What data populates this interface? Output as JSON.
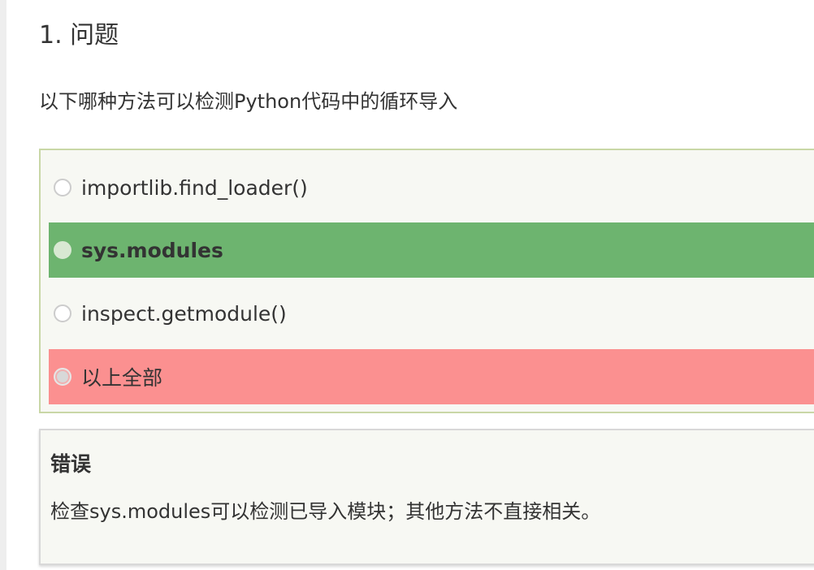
{
  "question": {
    "title": "1. 问题",
    "text": "以下哪种方法可以检测Python代码中的循环导入"
  },
  "options": [
    {
      "label": "importlib.find_loader()",
      "state": "neutral"
    },
    {
      "label": "sys.modules",
      "state": "correct"
    },
    {
      "label": "inspect.getmodule()",
      "state": "neutral"
    },
    {
      "label": "以上全部",
      "state": "wrong"
    }
  ],
  "feedback": {
    "title": "错误",
    "text": "检查sys.modules可以检测已导入模块；其他方法不直接相关。"
  },
  "colors": {
    "correct": "#6db46f",
    "wrong": "#fb9090",
    "panel_border": "#c9d7a6",
    "panel_bg": "#f7f8f3"
  }
}
